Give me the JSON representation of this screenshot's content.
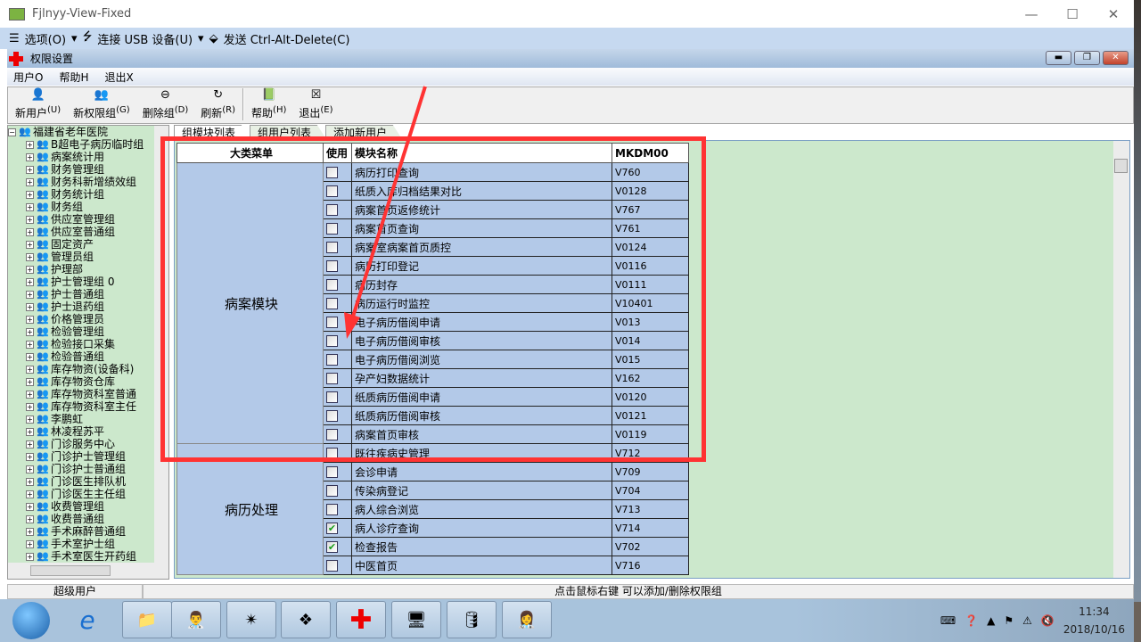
{
  "window": {
    "title": "Fjlnyy-View-Fixed",
    "controls": [
      "—",
      "☐",
      "✕"
    ]
  },
  "remote_bar": {
    "options": "选项(O)",
    "usb": "连接 USB 设备(U)",
    "cad": "发送 Ctrl-Alt-Delete(C)"
  },
  "app": {
    "title": "权限设置"
  },
  "menu": [
    "用户O",
    "帮助H",
    "退出X"
  ],
  "toolbar": [
    {
      "label": "新用户",
      "key": "(U)",
      "icon": "new-user-icon"
    },
    {
      "label": "新权限组",
      "key": "(G)",
      "icon": "new-group-icon"
    },
    {
      "label": "删除组",
      "key": "(D)",
      "icon": "delete-icon"
    },
    {
      "label": "刷新",
      "key": "(R)",
      "icon": "refresh-icon"
    },
    {
      "label": "帮助",
      "key": "(H)",
      "icon": "help-book-icon"
    },
    {
      "label": "退出",
      "key": "(E)",
      "icon": "exit-icon"
    }
  ],
  "tree": {
    "root": "福建省老年医院",
    "items": [
      "B超电子病历临时组",
      "病案统计用",
      "财务管理组",
      "财务科新增绩效组",
      "财务统计组",
      "财务组",
      "供应室管理组",
      "供应室普通组",
      "固定资产",
      "管理员组",
      "护理部",
      "护士管理组 0",
      "护士普通组",
      "护士退药组",
      "价格管理员",
      "检验管理组",
      "检验接口采集",
      "检验普通组",
      "库存物资(设备科)",
      "库存物资仓库",
      "库存物资科室普通",
      "库存物资科室主任",
      "李鹏虹",
      "林凌程苏平",
      "门诊服务中心",
      "门诊护士管理组",
      "门诊护士普通组",
      "门诊医生排队机",
      "门诊医生主任组",
      "收费管理组",
      "收费普通组",
      "手术麻醉普通组",
      "手术室护士组",
      "手术室医生开药组"
    ]
  },
  "tabs": [
    "组模块列表",
    "组用户列表",
    "添加新用户"
  ],
  "grid": {
    "headers": [
      "大类菜单",
      "使用",
      "模块名称",
      "MKDM00"
    ],
    "groups": [
      {
        "name": "病案模块",
        "rows": [
          {
            "name": "病历打印查询",
            "code": "V760",
            "checked": false
          },
          {
            "name": "纸质入库归档结果对比",
            "code": "V0128",
            "checked": false
          },
          {
            "name": "病案首页返修统计",
            "code": "V767",
            "checked": false
          },
          {
            "name": "病案首页查询",
            "code": "V761",
            "checked": false
          },
          {
            "name": "病案室病案首页质控",
            "code": "V0124",
            "checked": false
          },
          {
            "name": "病历打印登记",
            "code": "V0116",
            "checked": false
          },
          {
            "name": "病历封存",
            "code": "V0111",
            "checked": false
          },
          {
            "name": "病历运行时监控",
            "code": "V10401",
            "checked": false
          },
          {
            "name": "电子病历借阅申请",
            "code": "V013",
            "checked": false
          },
          {
            "name": "电子病历借阅审核",
            "code": "V014",
            "checked": false
          },
          {
            "name": "电子病历借阅浏览",
            "code": "V015",
            "checked": false
          },
          {
            "name": "孕产妇数据统计",
            "code": "V162",
            "checked": false
          },
          {
            "name": "纸质病历借阅申请",
            "code": "V0120",
            "checked": false
          },
          {
            "name": "纸质病历借阅审核",
            "code": "V0121",
            "checked": false
          },
          {
            "name": "病案首页审核",
            "code": "V0119",
            "checked": false
          }
        ]
      },
      {
        "name": "病历处理",
        "rows": [
          {
            "name": "既往疾病史管理",
            "code": "V712",
            "checked": false
          },
          {
            "name": "会诊申请",
            "code": "V709",
            "checked": false
          },
          {
            "name": "传染病登记",
            "code": "V704",
            "checked": false
          },
          {
            "name": "病人综合浏览",
            "code": "V713",
            "checked": false
          },
          {
            "name": "病人诊疗查询",
            "code": "V714",
            "checked": true
          },
          {
            "name": "检查报告",
            "code": "V702",
            "checked": true
          },
          {
            "name": "中医首页",
            "code": "V716",
            "checked": false
          }
        ]
      }
    ]
  },
  "status": {
    "user": "超级用户",
    "hint": "点击鼠标右键 可以添加/删除权限组"
  },
  "taskbar": {
    "apps": [
      "explorer-icon",
      "doctor-monitor-icon",
      "compass-icon",
      "crystal-icon",
      "red-cross-icon",
      "monitor-icon",
      "sql-icon",
      "nurse-icon"
    ]
  },
  "tray": {
    "time": "11:34",
    "date": "2018/10/16"
  },
  "annotation": {
    "color": "#ff3333"
  }
}
